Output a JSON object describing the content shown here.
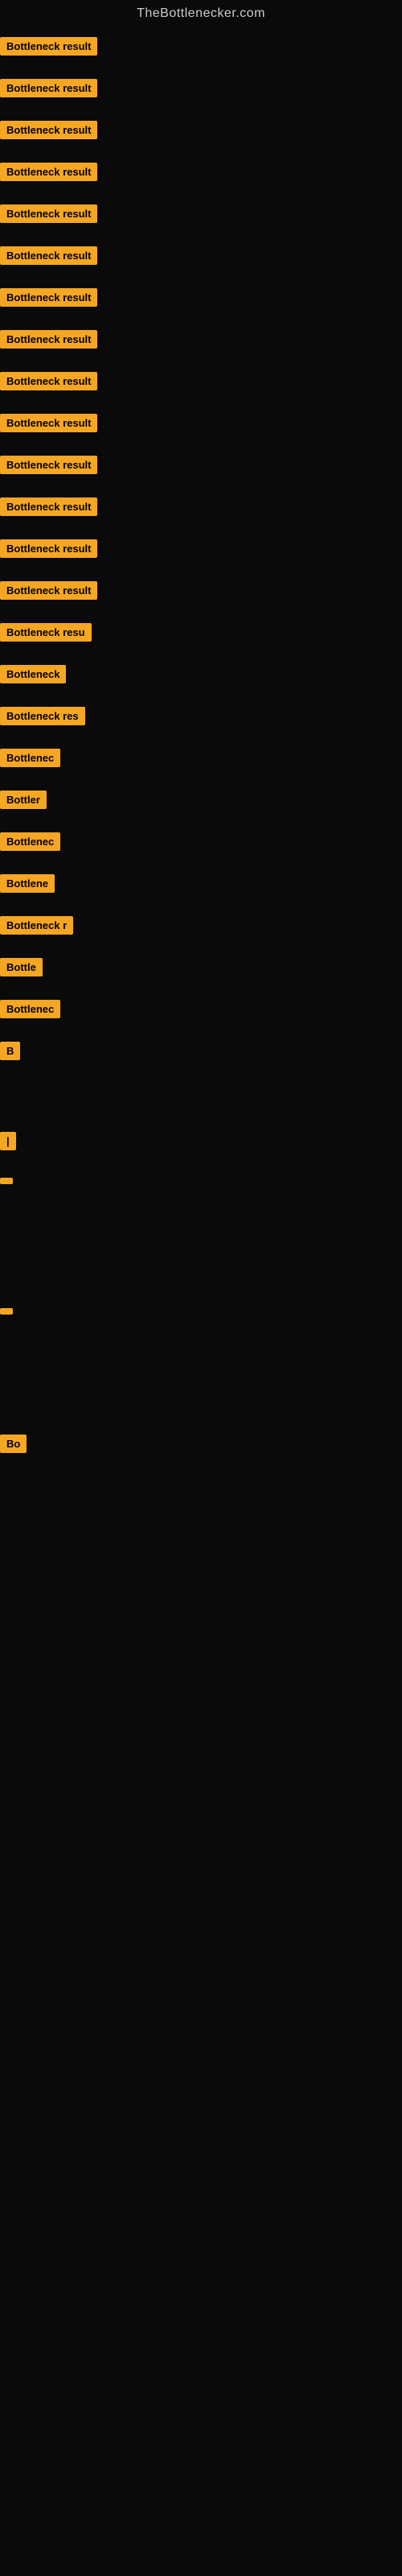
{
  "site": {
    "title": "TheBottlenecker.com"
  },
  "rows": [
    {
      "id": 1,
      "label": "Bottleneck result",
      "size_class": "row-full"
    },
    {
      "id": 2,
      "label": "Bottleneck result",
      "size_class": "row-full"
    },
    {
      "id": 3,
      "label": "Bottleneck result",
      "size_class": "row-full"
    },
    {
      "id": 4,
      "label": "Bottleneck result",
      "size_class": "row-full"
    },
    {
      "id": 5,
      "label": "Bottleneck result",
      "size_class": "row-full"
    },
    {
      "id": 6,
      "label": "Bottleneck result",
      "size_class": "row-full"
    },
    {
      "id": 7,
      "label": "Bottleneck result",
      "size_class": "row-full"
    },
    {
      "id": 8,
      "label": "Bottleneck result",
      "size_class": "row-full"
    },
    {
      "id": 9,
      "label": "Bottleneck result",
      "size_class": "row-full"
    },
    {
      "id": 10,
      "label": "Bottleneck result",
      "size_class": "row-full"
    },
    {
      "id": 11,
      "label": "Bottleneck result",
      "size_class": "row-full"
    },
    {
      "id": 12,
      "label": "Bottleneck result",
      "size_class": "row-full"
    },
    {
      "id": 13,
      "label": "Bottleneck result",
      "size_class": "row-full"
    },
    {
      "id": 14,
      "label": "Bottleneck result",
      "size_class": "row-full"
    },
    {
      "id": 15,
      "label": "Bottleneck resu",
      "size_class": "row-cut1"
    },
    {
      "id": 16,
      "label": "Bottleneck",
      "size_class": "row-cut2"
    },
    {
      "id": 17,
      "label": "Bottleneck res",
      "size_class": "row-cut3"
    },
    {
      "id": 18,
      "label": "Bottlenec",
      "size_class": "row-cut4"
    },
    {
      "id": 19,
      "label": "Bottler",
      "size_class": "row-cut5"
    },
    {
      "id": 20,
      "label": "Bottlenec",
      "size_class": "row-cut4"
    },
    {
      "id": 21,
      "label": "Bottlene",
      "size_class": "row-cut5"
    },
    {
      "id": 22,
      "label": "Bottleneck r",
      "size_class": "row-cut3"
    },
    {
      "id": 23,
      "label": "Bottle",
      "size_class": "row-cut5"
    },
    {
      "id": 24,
      "label": "Bottlenec",
      "size_class": "row-cut4"
    },
    {
      "id": 25,
      "label": "B",
      "size_class": "row-cut8"
    },
    {
      "id": 26,
      "label": "|",
      "size_class": "row-cut9"
    },
    {
      "id": 27,
      "label": "",
      "size_class": "row-cut10"
    },
    {
      "id": 28,
      "label": "",
      "size_class": "row-cut10"
    },
    {
      "id": 29,
      "label": "Bo",
      "size_class": "row-cut8"
    }
  ]
}
